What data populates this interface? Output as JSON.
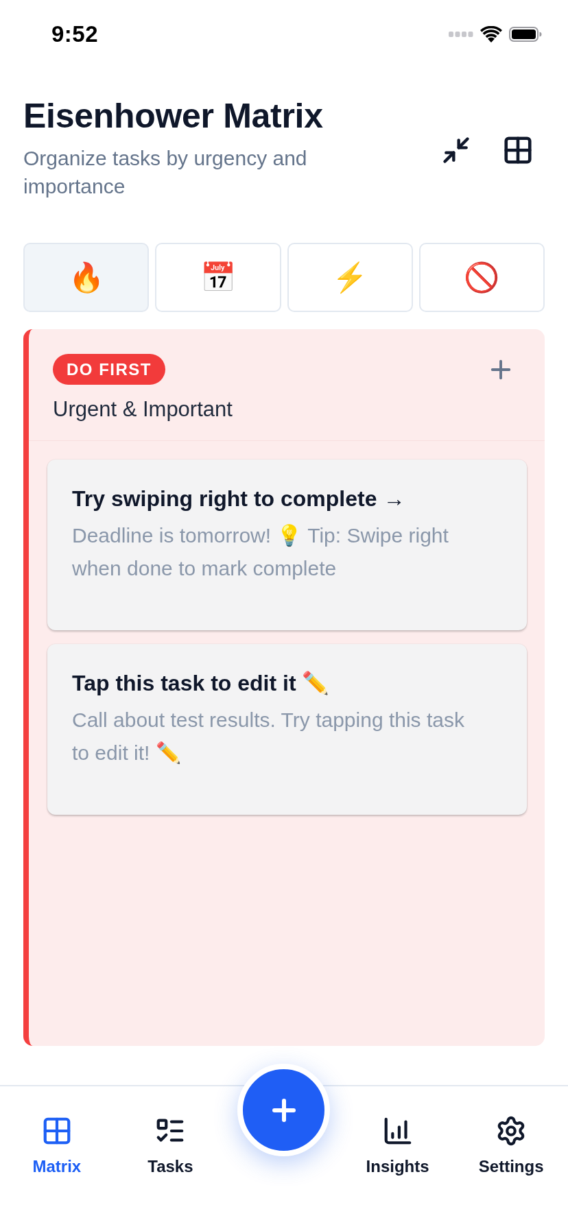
{
  "status_bar": {
    "time": "9:52"
  },
  "header": {
    "title": "Eisenhower Matrix",
    "subtitle": "Organize tasks by urgency and importance"
  },
  "filter_tabs": [
    {
      "label": "🔥",
      "selected": true
    },
    {
      "label": "📅",
      "selected": false
    },
    {
      "label": "⚡️",
      "selected": false
    },
    {
      "label": "🚫",
      "selected": false
    }
  ],
  "quadrant": {
    "badge": "DO FIRST",
    "subtitle": "Urgent & Important",
    "tasks": [
      {
        "title": "Try swiping right to complete →",
        "description": "Deadline is tomorrow! 💡 Tip: Swipe right when done to mark complete"
      },
      {
        "title": "Tap this task to edit it ✏️",
        "description": "Call about test results. Try tapping this task to edit it! ✏️"
      }
    ]
  },
  "nav": {
    "items": [
      {
        "kind": "matrix",
        "label": "Matrix",
        "selected": true
      },
      {
        "kind": "tasks",
        "label": "Tasks",
        "selected": false
      },
      {
        "kind": "add"
      },
      {
        "kind": "insights",
        "label": "Insights",
        "selected": false
      },
      {
        "kind": "settings",
        "label": "Settings",
        "selected": false
      }
    ]
  }
}
